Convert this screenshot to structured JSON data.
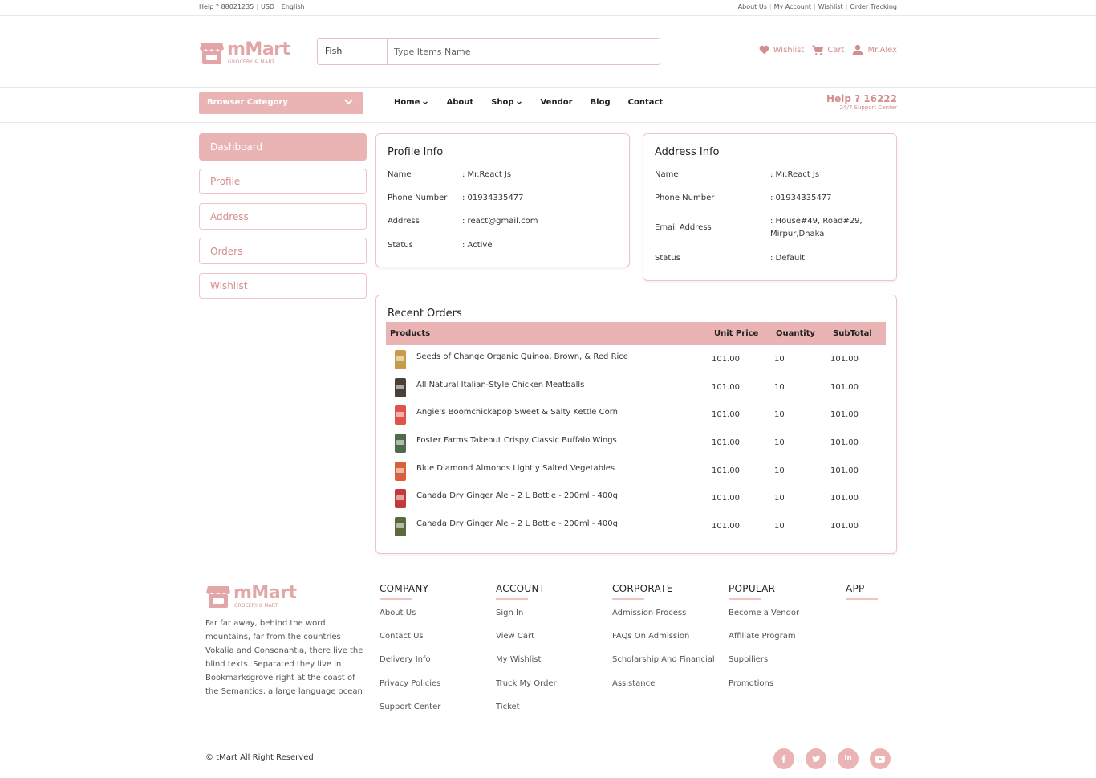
{
  "topbar": {
    "help": "Help ? 88021235",
    "currency": "USD",
    "language": "English",
    "links": [
      "About Us",
      "My Account",
      "Wishlist",
      "Order Tracking"
    ]
  },
  "brand": {
    "name": "mMart",
    "tagline": "GROCERY & MART"
  },
  "search": {
    "category": "Fish",
    "placeholder": "Type Items Name"
  },
  "header_links": {
    "wishlist": "Wishlist",
    "cart": "Cart",
    "user": "Mr.Alex"
  },
  "nav": {
    "browse": "Browser Category",
    "items": [
      "Home",
      "About",
      "Shop",
      "Vendor",
      "Blog",
      "Contact"
    ],
    "help_title": "Help ? 16222",
    "help_sub": "24/7 Support Center"
  },
  "sidebar": [
    "Dashboard",
    "Profile",
    "Address",
    "Orders",
    "Wishlist"
  ],
  "profile": {
    "title": "Profile Info",
    "rows": [
      {
        "label": "Name",
        "value": ": Mr.React Js"
      },
      {
        "label": "Phone Number",
        "value": ": 01934335477"
      },
      {
        "label": "Address",
        "value": ": react@gmail.com"
      },
      {
        "label": "Status",
        "value": ": Active"
      }
    ]
  },
  "address": {
    "title": "Address Info",
    "rows": [
      {
        "label": "Name",
        "value": ": Mr.React Js"
      },
      {
        "label": "Phone Number",
        "value": ": 01934335477"
      },
      {
        "label": "Email Address",
        "value": ": House#49, Road#29,",
        "value2": "Mirpur,Dhaka"
      },
      {
        "label": "Status",
        "value": ": Default"
      }
    ]
  },
  "orders": {
    "title": "Recent Orders",
    "headers": [
      "Products",
      "Unit Price",
      "Quantity",
      "SubTotal"
    ],
    "rows": [
      {
        "product": "Seeds of Change Organic Quinoa, Brown, & Red Rice",
        "price": "101.00",
        "qty": "10",
        "subtotal": "101.00",
        "color": "#c89b4a"
      },
      {
        "product": "All Natural Italian-Style Chicken Meatballs",
        "price": "101.00",
        "qty": "10",
        "subtotal": "101.00",
        "color": "#4a4038"
      },
      {
        "product": "Angie's Boomchickapop Sweet & Salty Kettle Corn",
        "price": "101.00",
        "qty": "10",
        "subtotal": "101.00",
        "color": "#e0534a"
      },
      {
        "product": "Foster Farms Takeout Crispy Classic Buffalo Wings",
        "price": "101.00",
        "qty": "10",
        "subtotal": "101.00",
        "color": "#4f6b4a"
      },
      {
        "product": "Blue Diamond Almonds Lightly Salted Vegetables",
        "price": "101.00",
        "qty": "10",
        "subtotal": "101.00",
        "color": "#d8603a"
      },
      {
        "product": "Canada Dry Ginger Ale – 2 L Bottle - 200ml - 400g",
        "price": "101.00",
        "qty": "10",
        "subtotal": "101.00",
        "color": "#c23b3b"
      },
      {
        "product": "Canada Dry Ginger Ale – 2 L Bottle - 200ml - 400g",
        "price": "101.00",
        "qty": "10",
        "subtotal": "101.00",
        "color": "#5a6a3c"
      }
    ]
  },
  "footer": {
    "desc": "Far far away, behind the word mountains, far from the countries Vokalia and Consonantia, there live the blind texts. Separated they live in Bookmarksgrove right at the coast of the Semantics, a large language ocean",
    "columns": [
      {
        "title": "COMPANY",
        "links": [
          "About Us",
          "Contact Us",
          "Delivery Info",
          "Privacy Policies",
          "Support Center"
        ]
      },
      {
        "title": "ACCOUNT",
        "links": [
          "Sign In",
          "View Cart",
          "My Wishlist",
          "Truck My Order",
          "Ticket"
        ]
      },
      {
        "title": "CORPORATE",
        "links": [
          "Admission Process",
          "FAQs On Admission",
          "Scholarship And Financial",
          "Assistance"
        ]
      },
      {
        "title": "POPULAR",
        "links": [
          "Become a Vendor",
          "Affiliate Program",
          "Suppiliers",
          "Promotions"
        ]
      },
      {
        "title": "APP",
        "links": []
      }
    ],
    "copyright": "© tMart All Right Reserved",
    "social": [
      "facebook-icon",
      "twitter-icon",
      "linkedin-icon",
      "youtube-icon"
    ]
  },
  "colors": {
    "accent": "#ebb4b4",
    "accent_text": "#d38e8e",
    "border": "#efc4c4"
  }
}
